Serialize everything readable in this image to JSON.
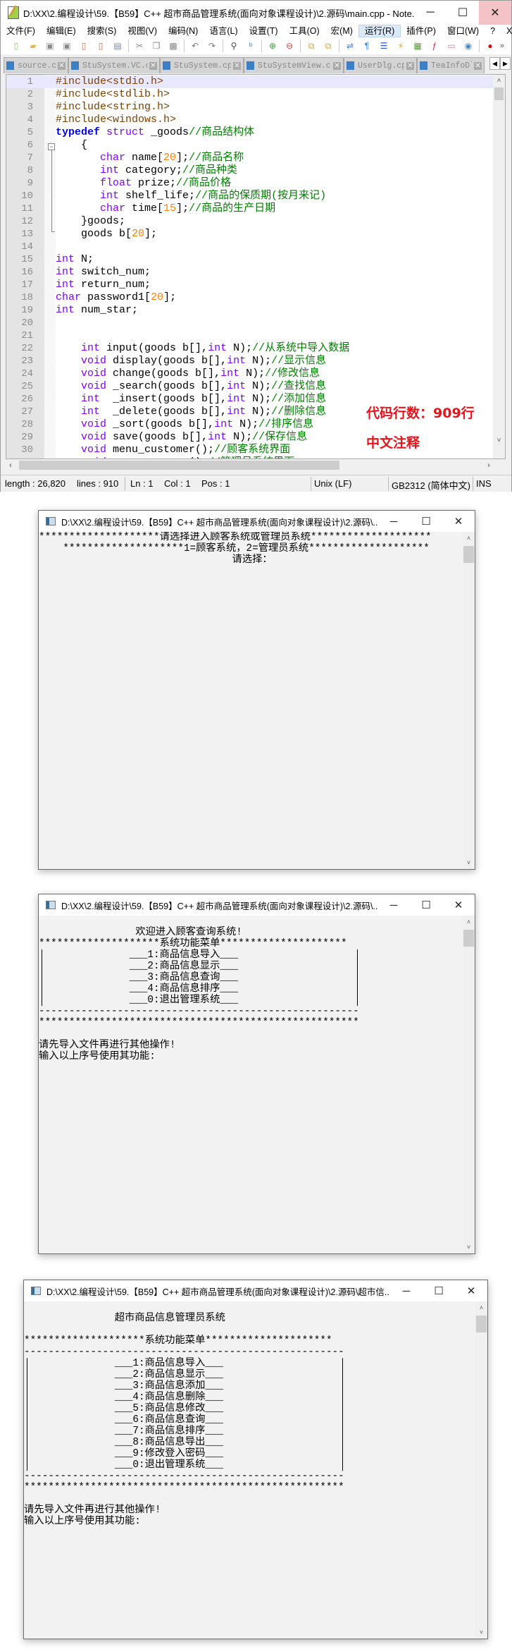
{
  "npp": {
    "title": "D:\\XX\\2.编程设计\\59.【B59】C++ 超市商品管理系统(面向对象课程设计)\\2.源码\\main.cpp - Note...",
    "window_buttons": {
      "minimize": "─",
      "maximize": "☐",
      "close": "✕"
    },
    "menu": [
      "文件(F)",
      "编辑(E)",
      "搜索(S)",
      "视图(V)",
      "编码(N)",
      "语言(L)",
      "设置(T)",
      "工具(O)",
      "宏(M)",
      "运行(R)",
      "插件(P)",
      "窗口(W)",
      "?"
    ],
    "menu_active": "运行(R)",
    "menu_close": "X",
    "toolbar": [
      {
        "icon": "new-file-icon",
        "glyph": "▯",
        "color": "#9bbf6a"
      },
      {
        "icon": "open-file-icon",
        "glyph": "▰",
        "color": "#e8b84a"
      },
      {
        "icon": "save-icon",
        "glyph": "▣",
        "color": "#8a8a8a"
      },
      {
        "icon": "save-all-icon",
        "glyph": "▣",
        "color": "#8a8a8a"
      },
      {
        "icon": "close-file-icon",
        "glyph": "▯",
        "color": "#e0603a"
      },
      {
        "icon": "close-all-icon",
        "glyph": "▯",
        "color": "#e0603a"
      },
      {
        "icon": "print-icon",
        "glyph": "▤",
        "color": "#7a8aa8"
      },
      {
        "sep": true
      },
      {
        "icon": "cut-icon",
        "glyph": "✂",
        "color": "#888888"
      },
      {
        "icon": "copy-icon",
        "glyph": "❐",
        "color": "#888888"
      },
      {
        "icon": "paste-icon",
        "glyph": "▩",
        "color": "#888888"
      },
      {
        "sep": true
      },
      {
        "icon": "undo-icon",
        "glyph": "↶",
        "color": "#777777"
      },
      {
        "icon": "redo-icon",
        "glyph": "↷",
        "color": "#777777"
      },
      {
        "sep": true
      },
      {
        "icon": "find-icon",
        "glyph": "⚲",
        "color": "#444444"
      },
      {
        "icon": "replace-icon",
        "glyph": "ᵇ",
        "color": "#3b7fd0"
      },
      {
        "sep": true
      },
      {
        "icon": "zoom-in-icon",
        "glyph": "⊕",
        "color": "#3a9a3a"
      },
      {
        "icon": "zoom-out-icon",
        "glyph": "⊖",
        "color": "#d04040"
      },
      {
        "sep": true
      },
      {
        "icon": "sync-vertical-icon",
        "glyph": "⧉",
        "color": "#d8a030"
      },
      {
        "icon": "sync-horizontal-icon",
        "glyph": "⧉",
        "color": "#d8a030"
      },
      {
        "sep": true
      },
      {
        "icon": "word-wrap-icon",
        "glyph": "⇌",
        "color": "#3b6fd0"
      },
      {
        "icon": "show-all-chars-icon",
        "glyph": "¶",
        "color": "#3b7fd0"
      },
      {
        "icon": "indent-guide-icon",
        "glyph": "☰",
        "color": "#2a4fd0"
      },
      {
        "icon": "user-language-icon",
        "glyph": "⚡",
        "color": "#e0a030"
      },
      {
        "icon": "document-map-icon",
        "glyph": "▦",
        "color": "#5a9a3a"
      },
      {
        "icon": "function-list-icon",
        "glyph": "ƒ",
        "color": "#d03030"
      },
      {
        "icon": "folder-workspace-icon",
        "glyph": "▭",
        "color": "#d87a8a"
      },
      {
        "icon": "monitor-icon",
        "glyph": "◉",
        "color": "#4a8ac0"
      },
      {
        "sep": true
      },
      {
        "icon": "record-macro-icon",
        "glyph": "●",
        "color": "#d01010"
      }
    ],
    "toolbar_more": "»",
    "tabs": [
      "source.c",
      "StuSystem.VC.db",
      "StuSystem.cpp",
      "StuSystemView.cpp",
      "UserDlg.cpp",
      "TeaInfoDlg.c"
    ],
    "tab_close": "✕",
    "tab_scroll": {
      "left": "◀",
      "right": "▶"
    },
    "code": [
      [
        [
          "pre",
          "#include<stdio.h>"
        ]
      ],
      [
        [
          "pre",
          "#include<stdlib.h>"
        ]
      ],
      [
        [
          "pre",
          "#include<string.h>"
        ]
      ],
      [
        [
          "pre",
          "#include<windows.h>"
        ]
      ],
      [
        [
          "kw",
          "typedef"
        ],
        [
          "plain",
          " "
        ],
        [
          "type",
          "struct"
        ],
        [
          "plain",
          " _goods"
        ],
        [
          "cmt",
          "//商品结构体"
        ]
      ],
      [
        [
          "plain",
          "    {"
        ]
      ],
      [
        [
          "plain",
          "       "
        ],
        [
          "type",
          "char"
        ],
        [
          "plain",
          " name["
        ],
        [
          "num",
          "20"
        ],
        [
          "plain",
          "];"
        ],
        [
          "cmt",
          "//商品名称"
        ]
      ],
      [
        [
          "plain",
          "       "
        ],
        [
          "type",
          "int"
        ],
        [
          "plain",
          " category;"
        ],
        [
          "cmt",
          "//商品种类"
        ]
      ],
      [
        [
          "plain",
          "       "
        ],
        [
          "type",
          "float"
        ],
        [
          "plain",
          " prize;"
        ],
        [
          "cmt",
          "//商品价格"
        ]
      ],
      [
        [
          "plain",
          "       "
        ],
        [
          "type",
          "int"
        ],
        [
          "plain",
          " shelf_life;"
        ],
        [
          "cmt",
          "//商品的保质期(按月来记)"
        ]
      ],
      [
        [
          "plain",
          "       "
        ],
        [
          "type",
          "char"
        ],
        [
          "plain",
          " time["
        ],
        [
          "num",
          "15"
        ],
        [
          "plain",
          "];"
        ],
        [
          "cmt",
          "//商品的生产日期"
        ]
      ],
      [
        [
          "plain",
          "    }goods;"
        ]
      ],
      [
        [
          "plain",
          "    goods b["
        ],
        [
          "num",
          "20"
        ],
        [
          "plain",
          "];"
        ]
      ],
      [],
      [
        [
          "type",
          "int"
        ],
        [
          "plain",
          " N;"
        ]
      ],
      [
        [
          "type",
          "int"
        ],
        [
          "plain",
          " switch_num;"
        ]
      ],
      [
        [
          "type",
          "int"
        ],
        [
          "plain",
          " return_num;"
        ]
      ],
      [
        [
          "type",
          "char"
        ],
        [
          "plain",
          " password1["
        ],
        [
          "num",
          "20"
        ],
        [
          "plain",
          "];"
        ]
      ],
      [
        [
          "type",
          "int"
        ],
        [
          "plain",
          " num_star;"
        ]
      ],
      [],
      [],
      [
        [
          "plain",
          "    "
        ],
        [
          "type",
          "int"
        ],
        [
          "plain",
          " input(goods b[],"
        ],
        [
          "type",
          "int"
        ],
        [
          "plain",
          " N);"
        ],
        [
          "cmt",
          "//从系统中导入数据"
        ]
      ],
      [
        [
          "plain",
          "    "
        ],
        [
          "type",
          "void"
        ],
        [
          "plain",
          " display(goods b[],"
        ],
        [
          "type",
          "int"
        ],
        [
          "plain",
          " N);"
        ],
        [
          "cmt",
          "//显示信息"
        ]
      ],
      [
        [
          "plain",
          "    "
        ],
        [
          "type",
          "void"
        ],
        [
          "plain",
          " change(goods b[],"
        ],
        [
          "type",
          "int"
        ],
        [
          "plain",
          " N);"
        ],
        [
          "cmt",
          "//修改信息"
        ]
      ],
      [
        [
          "plain",
          "    "
        ],
        [
          "type",
          "void"
        ],
        [
          "plain",
          " _search(goods b[],"
        ],
        [
          "type",
          "int"
        ],
        [
          "plain",
          " N);"
        ],
        [
          "cmt",
          "//查找信息"
        ]
      ],
      [
        [
          "plain",
          "    "
        ],
        [
          "type",
          "int"
        ],
        [
          "plain",
          "  _insert(goods b[],"
        ],
        [
          "type",
          "int"
        ],
        [
          "plain",
          " N);"
        ],
        [
          "cmt",
          "//添加信息"
        ]
      ],
      [
        [
          "plain",
          "    "
        ],
        [
          "type",
          "int"
        ],
        [
          "plain",
          "  _delete(goods b[],"
        ],
        [
          "type",
          "int"
        ],
        [
          "plain",
          " N);"
        ],
        [
          "cmt",
          "//删除信息"
        ]
      ],
      [
        [
          "plain",
          "    "
        ],
        [
          "type",
          "void"
        ],
        [
          "plain",
          " _sort(goods b[],"
        ],
        [
          "type",
          "int"
        ],
        [
          "plain",
          " N);"
        ],
        [
          "cmt",
          "//排序信息"
        ]
      ],
      [
        [
          "plain",
          "    "
        ],
        [
          "type",
          "void"
        ],
        [
          "plain",
          " save(goods b[],"
        ],
        [
          "type",
          "int"
        ],
        [
          "plain",
          " N);"
        ],
        [
          "cmt",
          "//保存信息"
        ]
      ],
      [
        [
          "plain",
          "    "
        ],
        [
          "type",
          "void"
        ],
        [
          "plain",
          " menu_customer();"
        ],
        [
          "cmt",
          "//顾客系统界面"
        ]
      ],
      [
        [
          "plain",
          "    "
        ],
        [
          "type",
          "void"
        ],
        [
          "plain",
          " menu_manager();"
        ],
        [
          "cmt",
          "//管理员系统界面"
        ]
      ]
    ],
    "syntax_colors": {
      "pre": "#804000",
      "kw": "#0000ff",
      "type": "#8000ff",
      "num": "#ff8000",
      "cmt": "#008000"
    },
    "annotations": [
      "代码行数：909行",
      "中文注释"
    ],
    "annotation_color": "#e8141c",
    "status": {
      "length": "length : 26,820",
      "lines": "lines : 910",
      "ln": "Ln : 1",
      "col": "Col : 1",
      "pos": "Pos : 1",
      "eol": "Unix (LF)",
      "encoding": "GB2312 (简体中文)",
      "mode": "INS"
    }
  },
  "consoles": [
    {
      "title": "D:\\XX\\2.编程设计\\59.【B59】C++ 超市商品管理系统(面向对象课程设计)\\2.源码\\...",
      "rows": [
        {
          "text": "********************请选择进入顾客系统或管理员系统********************"
        },
        {
          "text": "    ********************1=顾客系统，2=管理员系统********************"
        },
        {
          "text": "                                请选择："
        }
      ]
    },
    {
      "title": "D:\\XX\\2.编程设计\\59.【B59】C++ 超市商品管理系统(面向对象课程设计)\\2.源码\\...",
      "rows": [
        {
          "text": ""
        },
        {
          "text": "                欢迎进入顾客查询系统!"
        },
        {
          "text": "********************系统功能菜单*********************"
        },
        {
          "text": "               ___1:商品信息导入___",
          "box": true
        },
        {
          "text": "               ___2:商品信息显示___",
          "box": true
        },
        {
          "text": "               ___3:商品信息查询___",
          "box": true
        },
        {
          "text": "               ___4:商品信息排序___",
          "box": true
        },
        {
          "text": "               ___0:退出管理系统___",
          "box": true
        },
        {
          "text": "-----------------------------------------------------"
        },
        {
          "text": "*****************************************************"
        },
        {
          "text": ""
        },
        {
          "text": "请先导入文件再进行其他操作!"
        },
        {
          "text": "输入以上序号使用其功能:"
        }
      ]
    },
    {
      "title": "D:\\XX\\2.编程设计\\59.【B59】C++ 超市商品管理系统(面向对象课程设计)\\2.源码\\超市信...",
      "rows": [
        {
          "text": ""
        },
        {
          "text": "               超市商品信息管理员系统"
        },
        {
          "text": ""
        },
        {
          "text": "********************系统功能菜单*********************"
        },
        {
          "text": "-----------------------------------------------------"
        },
        {
          "text": "               ___1:商品信息导入___",
          "box": true
        },
        {
          "text": "               ___2:商品信息显示___",
          "box": true
        },
        {
          "text": "               ___3:商品信息添加___",
          "box": true
        },
        {
          "text": "               ___4:商品信息删除___",
          "box": true
        },
        {
          "text": "               ___5:商品信息修改___",
          "box": true
        },
        {
          "text": "               ___6:商品信息查询___",
          "box": true
        },
        {
          "text": "               ___7:商品信息排序___",
          "box": true
        },
        {
          "text": "               ___8:商品信息导出___",
          "box": true
        },
        {
          "text": "               ___9:修改登入密码___",
          "box": true
        },
        {
          "text": "               ___0:退出管理系统___",
          "box": true
        },
        {
          "text": "-----------------------------------------------------"
        },
        {
          "text": "*****************************************************"
        },
        {
          "text": ""
        },
        {
          "text": "请先导入文件再进行其他操作!"
        },
        {
          "text": "输入以上序号使用其功能:"
        }
      ]
    }
  ],
  "console_buttons": {
    "minimize": "─",
    "maximize": "☐",
    "close": "✕"
  },
  "scroll_arrows": {
    "up": "˄",
    "down": "˅",
    "left": "‹",
    "right": "›"
  }
}
